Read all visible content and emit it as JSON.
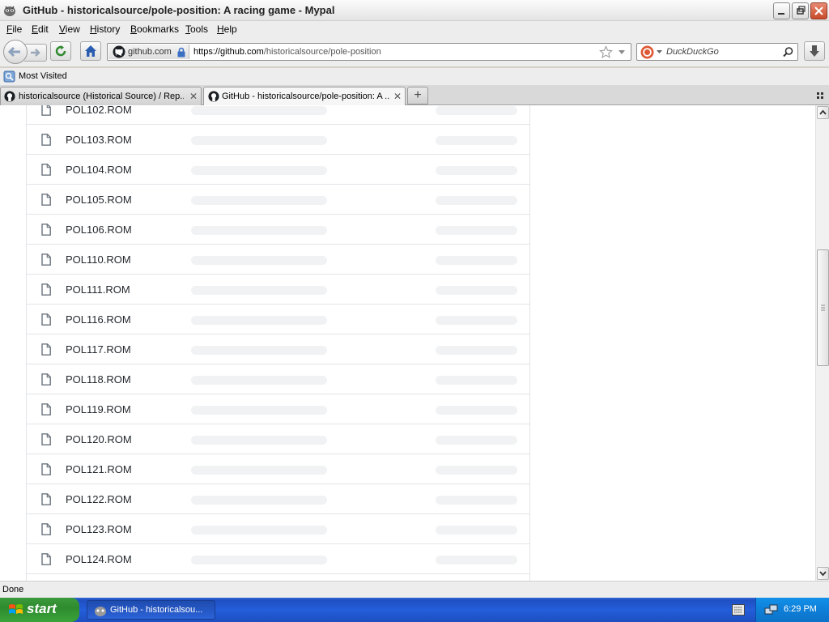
{
  "window": {
    "title": "GitHub - historicalsource/pole-position: A racing game - Mypal"
  },
  "menubar": {
    "items": [
      "File",
      "Edit",
      "View",
      "History",
      "Bookmarks",
      "Tools",
      "Help"
    ]
  },
  "navbar": {
    "identity_label": "github.com",
    "url_prefix": "https://github.com",
    "url_path": "/historicalsource/pole-position",
    "search_placeholder": "DuckDuckGo"
  },
  "bookmarks": {
    "most_visited": "Most Visited"
  },
  "tabs": [
    {
      "label": "historicalsource (Historical Source) / Rep...",
      "active": false
    },
    {
      "label": "GitHub - historicalsource/pole-position: A ...",
      "active": true
    }
  ],
  "files": [
    "POL102.ROM",
    "POL103.ROM",
    "POL104.ROM",
    "POL105.ROM",
    "POL106.ROM",
    "POL110.ROM",
    "POL111.ROM",
    "POL116.ROM",
    "POL117.ROM",
    "POL118.ROM",
    "POL119.ROM",
    "POL120.ROM",
    "POL121.ROM",
    "POL122.ROM",
    "POL123.ROM",
    "POL124.ROM",
    ""
  ],
  "status": {
    "text": "Done"
  },
  "taskbar": {
    "start_label": "start",
    "task_label": "GitHub - historicalsou...",
    "clock": "6:29 PM"
  },
  "colors": {
    "taskbar_blue": "#245edb",
    "start_green": "#3aa33a",
    "placeholder_gray": "#f1f2f4",
    "row_border": "#e1e4e8"
  }
}
